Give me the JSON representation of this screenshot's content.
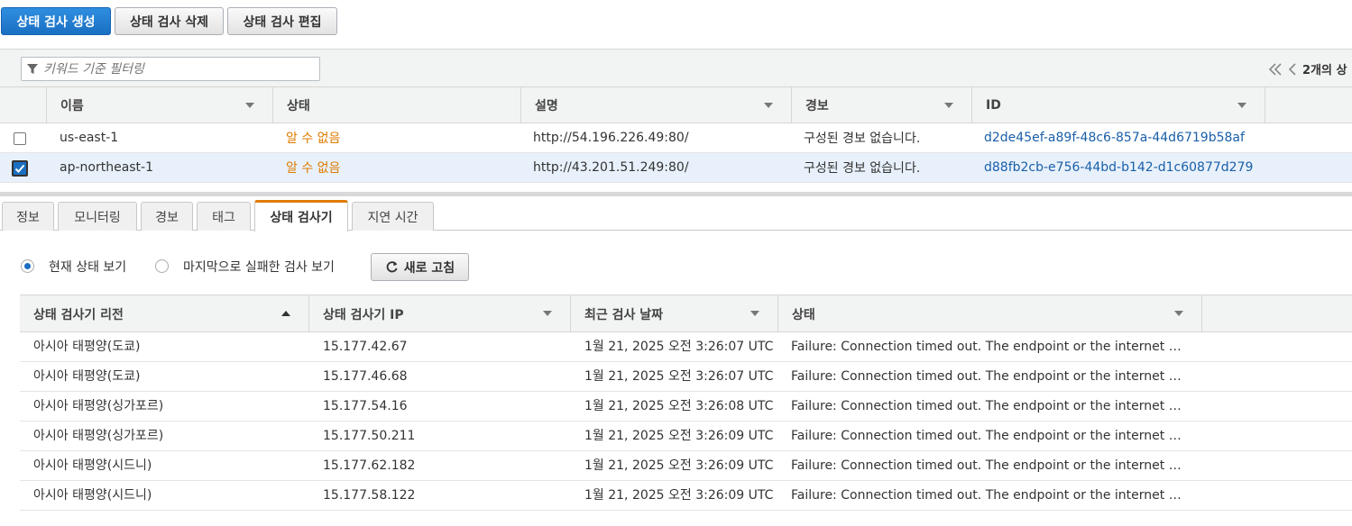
{
  "toolbar": {
    "create": "상태 검사 생성",
    "delete": "상태 검사 삭제",
    "edit": "상태 검사 편집"
  },
  "filter": {
    "placeholder": "키워드 기준 필터링"
  },
  "pager": {
    "count_text": "2개의 상"
  },
  "table": {
    "headers": [
      "이름",
      "상태",
      "설명",
      "경보",
      "ID"
    ],
    "rows": [
      {
        "checked": false,
        "name": "us-east-1",
        "status": "알 수 없음",
        "description": "http://54.196.226.49:80/",
        "alarm": "구성된 경보 없습니다.",
        "id": "d2de45ef-a89f-48c6-857a-44d6719b58af"
      },
      {
        "checked": true,
        "name": "ap-northeast-1",
        "status": "알 수 없음",
        "description": "http://43.201.51.249:80/",
        "alarm": "구성된 경보 없습니다.",
        "id": "d88fb2cb-e756-44bd-b142-d1c60877d279"
      }
    ]
  },
  "tabs": [
    "정보",
    "모니터링",
    "경보",
    "태그",
    "상태 검사기",
    "지연 시간"
  ],
  "active_tab": "상태 검사기",
  "view": {
    "current": "현재 상태 보기",
    "last_failed": "마지막으로 실패한 검사 보기",
    "refresh": "새로 고침"
  },
  "checkers": {
    "headers": [
      "상태 검사기 리전",
      "상태 검사기 IP",
      "최근 검사 날짜",
      "상태"
    ],
    "rows": [
      {
        "region": "아시아 태평양(도쿄)",
        "ip": "15.177.42.67",
        "date": "1월 21, 2025 오전 3:26:07 UTC",
        "status": "Failure: Connection timed out. The endpoint or the internet connecti…"
      },
      {
        "region": "아시아 태평양(도쿄)",
        "ip": "15.177.46.68",
        "date": "1월 21, 2025 오전 3:26:07 UTC",
        "status": "Failure: Connection timed out. The endpoint or the internet connecti…"
      },
      {
        "region": "아시아 태평양(싱가포르)",
        "ip": "15.177.54.16",
        "date": "1월 21, 2025 오전 3:26:08 UTC",
        "status": "Failure: Connection timed out. The endpoint or the internet connecti…"
      },
      {
        "region": "아시아 태평양(싱가포르)",
        "ip": "15.177.50.211",
        "date": "1월 21, 2025 오전 3:26:09 UTC",
        "status": "Failure: Connection timed out. The endpoint or the internet connecti…"
      },
      {
        "region": "아시아 태평양(시드니)",
        "ip": "15.177.62.182",
        "date": "1월 21, 2025 오전 3:26:09 UTC",
        "status": "Failure: Connection timed out. The endpoint or the internet connecti…"
      },
      {
        "region": "아시아 태평양(시드니)",
        "ip": "15.177.58.122",
        "date": "1월 21, 2025 오전 3:26:09 UTC",
        "status": "Failure: Connection timed out. The endpoint or the internet connecti…"
      }
    ]
  },
  "colors": {
    "primary": "#1a6fc2",
    "warning": "#e07b00",
    "link": "#1a5fa8"
  }
}
